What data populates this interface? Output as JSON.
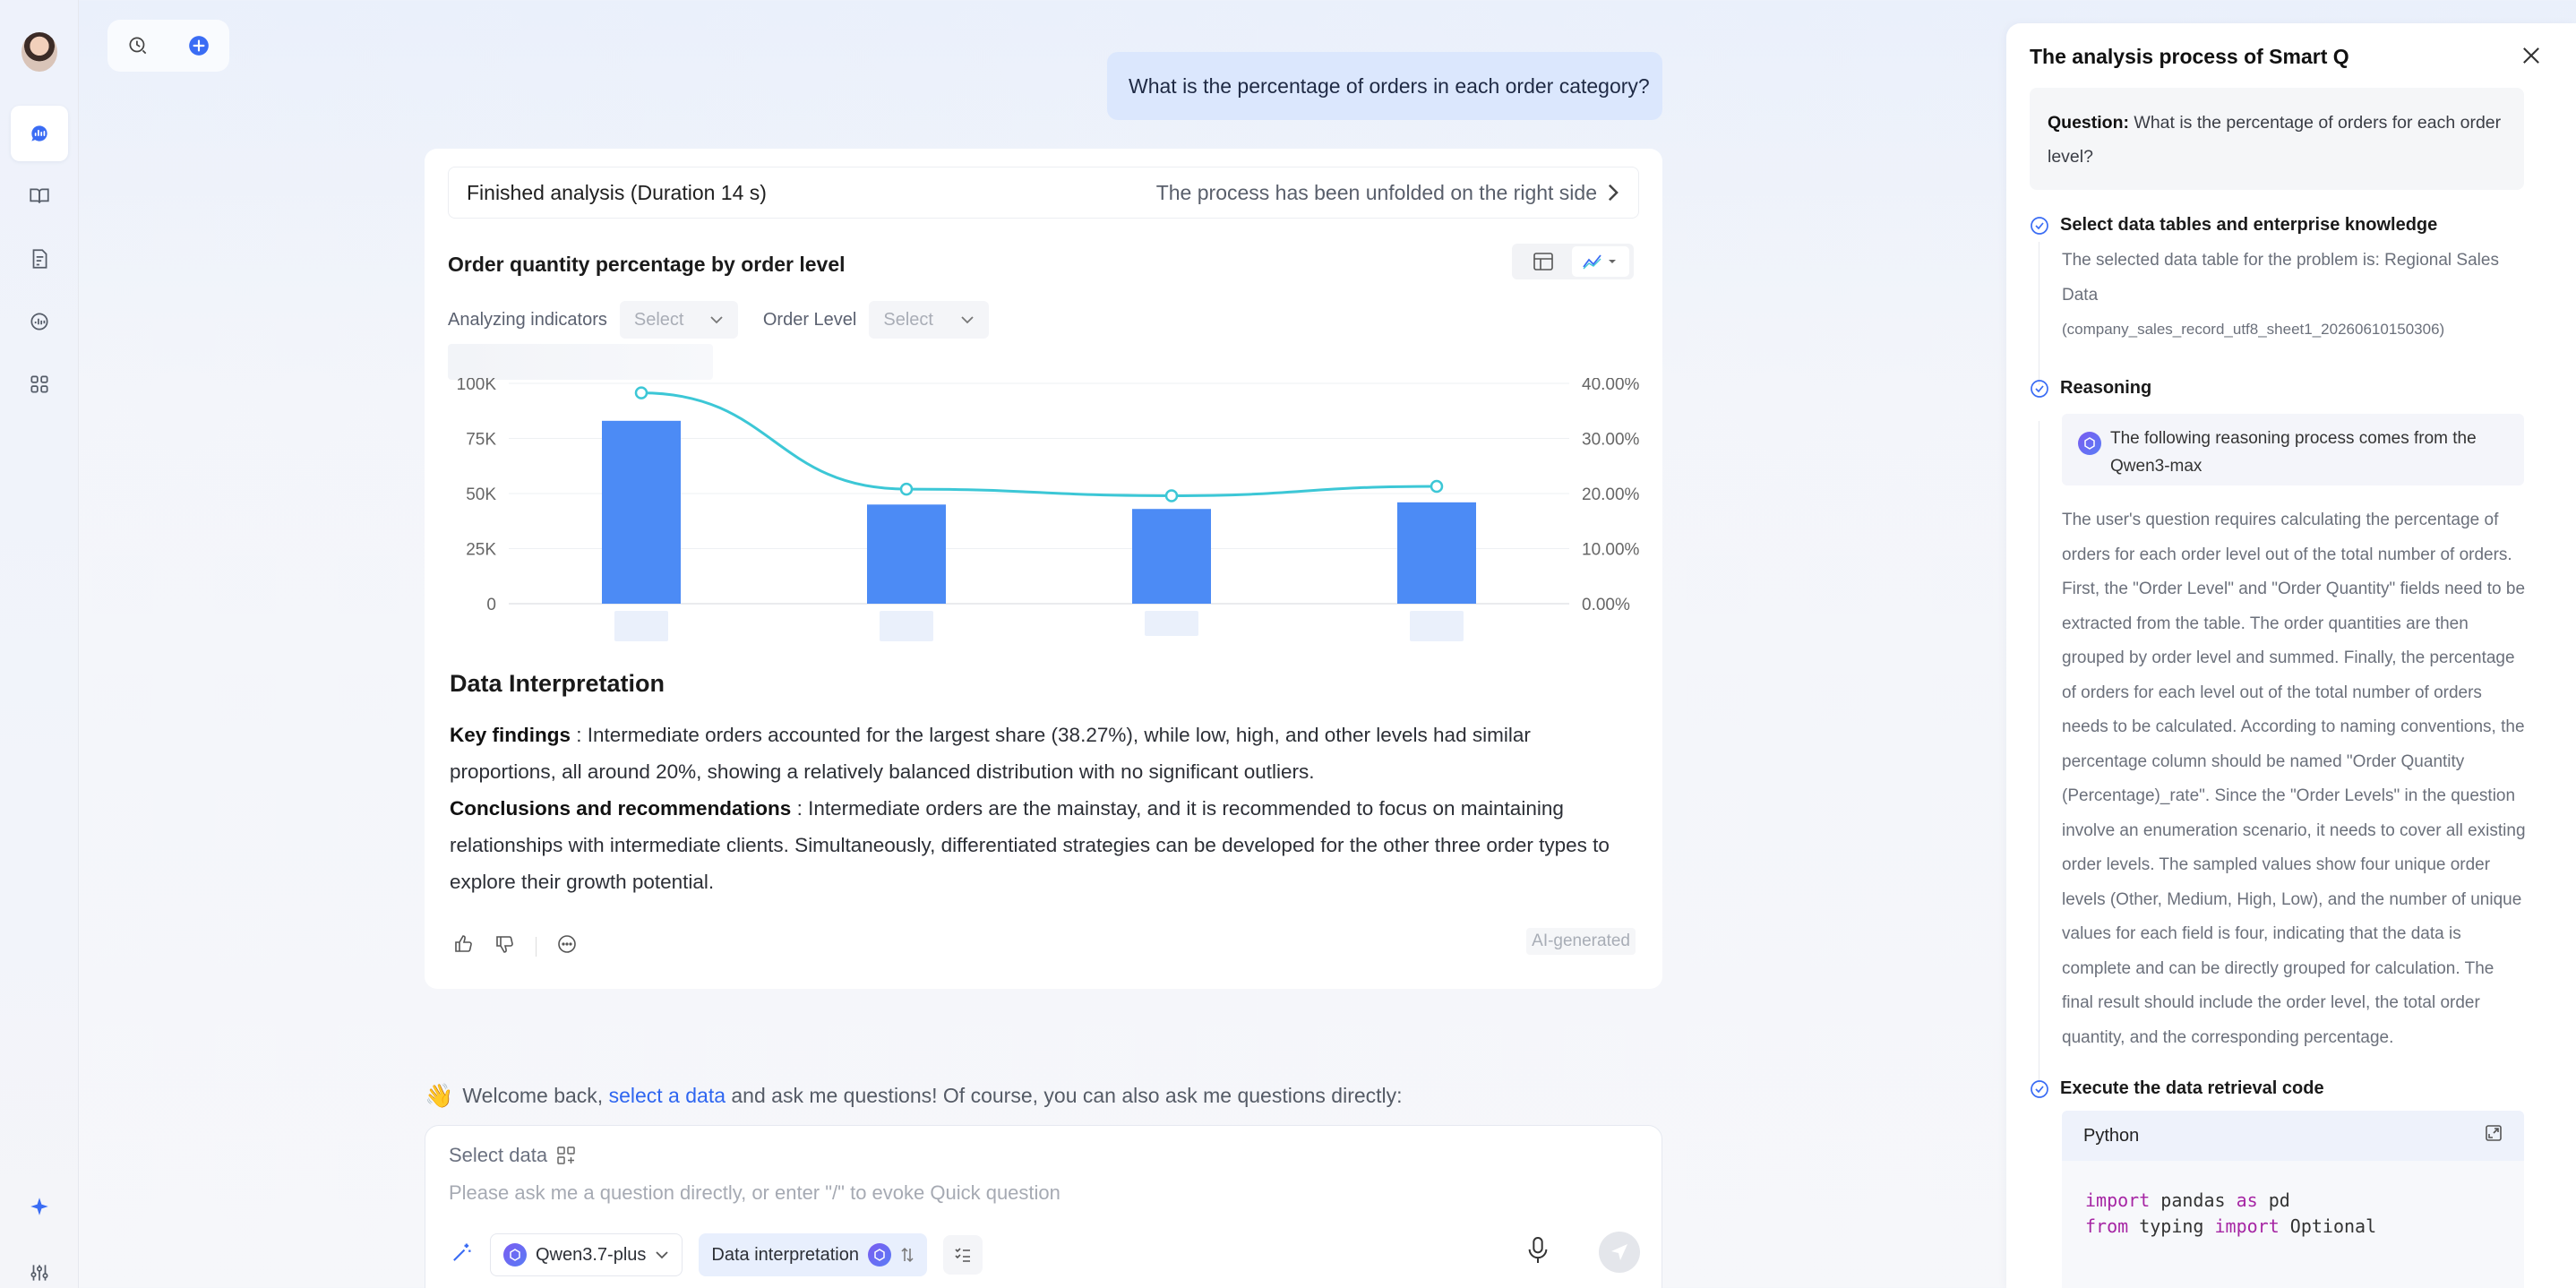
{
  "sidebar": {
    "items": [
      "chat-icon",
      "book-icon",
      "report-icon",
      "analysis-icon",
      "apps-icon"
    ],
    "bottom": [
      "sparkle-icon",
      "settings-sliders-icon"
    ]
  },
  "conversation": {
    "user_question": "What is the percentage of orders in each order category?",
    "finished": "Finished analysis (Duration 14 s)",
    "process_hint": "The process has been unfolded on the right side",
    "chart_title": "Order quantity percentage by order level",
    "filters": {
      "indicators_label": "Analyzing indicators",
      "indicators_value": "Select",
      "level_label": "Order Level",
      "level_value": "Select"
    },
    "interpretation": {
      "title": "Data Interpretation",
      "findings_label": "Key findings",
      "findings": " : Intermediate orders accounted for the largest share (38.27%), while low, high, and other levels had similar proportions, all around 20%, showing a relatively balanced distribution with no significant outliers.",
      "conclusions_label": "Conclusions and recommendations",
      "conclusions": " : Intermediate orders are the mainstay, and it is recommended to focus on maintaining relationships with intermediate clients. Simultaneously, differentiated strategies can be developed for the other three order types to explore their growth potential."
    },
    "ai_tag": "AI-generated"
  },
  "chart_data": {
    "type": "bar",
    "categories": [
      "",
      "",
      "",
      ""
    ],
    "series": [
      {
        "type": "bar",
        "values": [
          83000,
          45000,
          43000,
          46000
        ]
      },
      {
        "type": "line",
        "axis": "right",
        "values": [
          38.27,
          20.8,
          19.6,
          21.3
        ]
      }
    ],
    "ylim": [
      0,
      100000
    ],
    "y_ticks": [
      "100K",
      "75K",
      "50K",
      "25K",
      "0"
    ],
    "y2lim": [
      0,
      40
    ],
    "y2_ticks": [
      "40.00%",
      "30.00%",
      "20.00%",
      "10.00%",
      "0.00%"
    ],
    "colors": {
      "bar": "#4c8bf5",
      "line": "#3cc7d6"
    },
    "grid": true
  },
  "composer": {
    "welcome_pre": "Welcome back, ",
    "welcome_link": "select a data",
    "welcome_post": " and ask me questions! Of course, you can also ask me questions directly:",
    "select_data": "Select data",
    "placeholder": "Please ask me a question directly, or enter \"/\" to evoke Quick question",
    "model": "Qwen3.7-plus",
    "mode": "Data interpretation"
  },
  "panel": {
    "title": "The analysis process of Smart Q",
    "question_label": "Question:",
    "question": " What is the percentage of orders for each order level?",
    "step1_title": "Select data tables and enterprise knowledge",
    "step1_body1": "The selected data table for the problem is: Regional Sales Data",
    "step1_body2": "(company_sales_record_utf8_sheet1_20260610150306)",
    "step2_title": "Reasoning",
    "step2_source": "The following reasoning process comes from the Qwen3-max",
    "step2_body": "The user's question requires calculating the percentage of orders for each order level out of the total number of orders. First, the \"Order Level\" and \"Order Quantity\" fields need to be extracted from the table. The order quantities are then grouped by order level and summed. Finally, the percentage of orders for each level out of the total number of orders needs to be calculated. According to naming conventions, the percentage column should be named \"Order Quantity (Percentage)_rate\". Since the \"Order Levels\" in the question involve an enumeration scenario, it needs to cover all existing order levels. The sampled values show four unique order levels (Other, Medium, High, Low), and the number of unique values for each field is four, indicating that the data is complete and can be directly grouped for calculation. The final result should include the order level, the total order quantity, and the corresponding percentage.",
    "step3_title": "Execute the data retrieval code",
    "code_lang": "Python",
    "code_line1_kw1": "import",
    "code_line1_rest": " pandas ",
    "code_line1_kw2": "as",
    "code_line1_end": " pd",
    "code_line2_kw1": "from",
    "code_line2_rest": " typing ",
    "code_line2_kw2": "import",
    "code_line2_end": " Optional"
  }
}
